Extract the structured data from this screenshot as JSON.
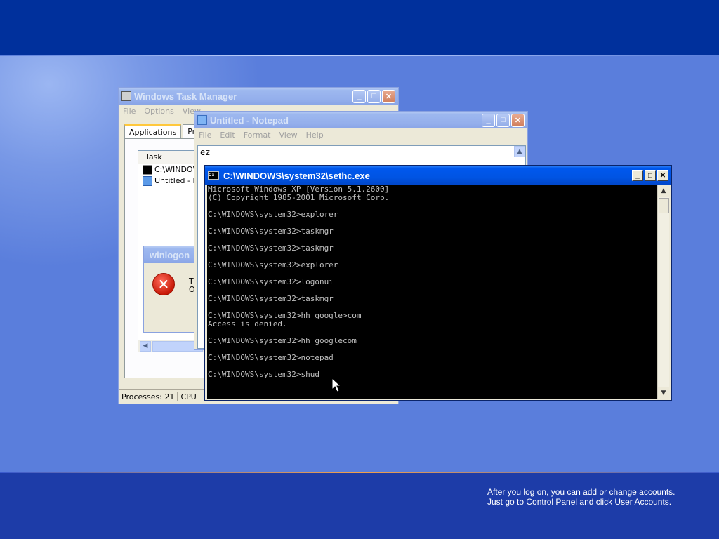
{
  "desktop": {
    "logon_hint_line1": "After you log on, you can add or change accounts.",
    "logon_hint_line2": "Just go to Control Panel and click User Accounts."
  },
  "taskmgr": {
    "title": "Windows Task Manager",
    "menu": [
      "File",
      "Options",
      "View"
    ],
    "tabs": [
      "Applications",
      "Proce"
    ],
    "column_task": "Task",
    "rows": [
      "C:\\WINDOW",
      "Untitled - No"
    ],
    "status_processes": "Processes: 21",
    "status_cpu": "CPU"
  },
  "winlogon": {
    "title": "winlogon",
    "text_line1": "Th",
    "text_line2": "O"
  },
  "notepad": {
    "title": "Untitled - Notepad",
    "menu": [
      "File",
      "Edit",
      "Format",
      "View",
      "Help"
    ],
    "content": "ez"
  },
  "cmd": {
    "title": "C:\\WINDOWS\\system32\\sethc.exe",
    "lines": [
      "Microsoft Windows XP [Version 5.1.2600]",
      "(C) Copyright 1985-2001 Microsoft Corp.",
      "",
      "C:\\WINDOWS\\system32>explorer",
      "",
      "C:\\WINDOWS\\system32>taskmgr",
      "",
      "C:\\WINDOWS\\system32>taskmgr",
      "",
      "C:\\WINDOWS\\system32>explorer",
      "",
      "C:\\WINDOWS\\system32>logonui",
      "",
      "C:\\WINDOWS\\system32>taskmgr",
      "",
      "C:\\WINDOWS\\system32>hh google>com",
      "Access is denied.",
      "",
      "C:\\WINDOWS\\system32>hh googlecom",
      "",
      "C:\\WINDOWS\\system32>notepad",
      "",
      "C:\\WINDOWS\\system32>shud"
    ]
  },
  "colors": {
    "titlebar_active": "#0054e3",
    "desktop": "#5a7edc",
    "console_bg": "#000000",
    "console_text": "#c0c0c0"
  }
}
